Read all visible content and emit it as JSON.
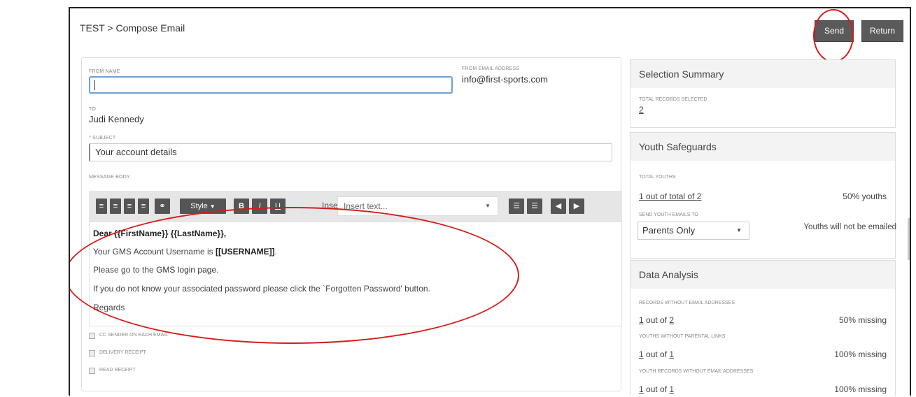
{
  "header": {
    "breadcrumb": "TEST > Compose Email",
    "send_label": "Send",
    "return_label": "Return"
  },
  "form": {
    "from_name_label": "FROM NAME",
    "from_name_value": "",
    "from_email_label": "FROM EMAIL ADDRESS",
    "from_email_value": "info@first-sports.com",
    "to_label": "TO",
    "to_value": "Judi Kennedy",
    "subject_label": "* SUBJECT",
    "subject_value": "Your account details",
    "message_body_label": "MESSAGE BODY"
  },
  "toolbar": {
    "style_label": "Style",
    "bold_label": "B",
    "italic_label": "I",
    "underline_label": "U",
    "insert_label": "Insert",
    "insert_placeholder": "Insert text..."
  },
  "message": {
    "greeting": "Dear {{FirstName}} {{LastName}},",
    "line2_prefix": "Your GMS Account Username is ",
    "line2_token": "[[USERNAME]]",
    "line2_suffix": ".",
    "line3_prefix": "Please go to the ",
    "line3_link": "GMS login page",
    "line3_suffix": ".",
    "line4": "If you do not know your associated password please click the `Forgotten Password' button.",
    "line5": "Regards"
  },
  "options": [
    {
      "label": "CC SENDER ON EACH EMAIL"
    },
    {
      "label": "DELIVERY RECEIPT"
    },
    {
      "label": "READ RECEIPT"
    }
  ],
  "selection_summary": {
    "title": "Selection Summary",
    "total_label": "TOTAL RECORDS SELECTED",
    "total_value": "2"
  },
  "youth_safeguards": {
    "title": "Youth Safeguards",
    "total_youths_label": "TOTAL YOUTHS",
    "youths_prefix": "1 out of total of ",
    "youths_total": "2",
    "youths_percent": "50% youths",
    "send_to_label": "SEND YOUTH EMAILS TO",
    "send_to_value": "Parents Only",
    "note": "Youths will not be emailed"
  },
  "data_analysis": {
    "title": "Data Analysis",
    "rows": [
      {
        "label": "RECORDS WITHOUT EMAIL ADDRESSES",
        "count": "1",
        "of_prefix": " out of ",
        "total": "2",
        "missing": "50% missing"
      },
      {
        "label": "YOUTHS WITHOUT PARENTAL LINKS",
        "count": "1",
        "of_prefix": " out of ",
        "total": "1",
        "missing": "100% missing"
      },
      {
        "label": "YOUTH RECORDS WITHOUT EMAIL ADDRESSES",
        "count": "1",
        "of_prefix": " out of ",
        "total": "1",
        "missing": "100% missing"
      }
    ]
  },
  "annotation_color": "#d91a1a"
}
